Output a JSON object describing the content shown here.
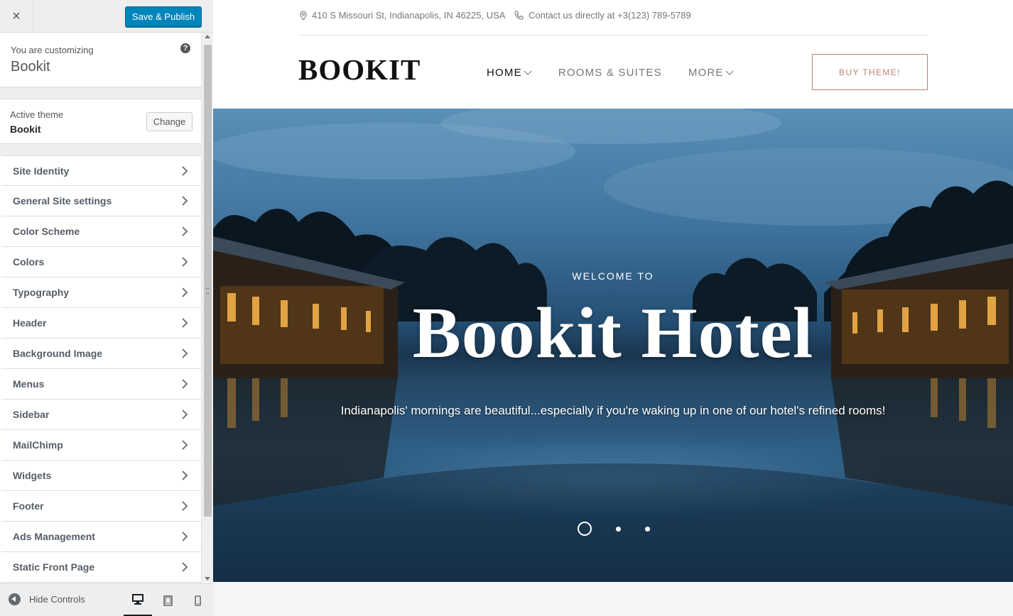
{
  "customizer": {
    "close_label": "×",
    "publish_label": "Save & Publish",
    "customizing_label": "You are customizing",
    "site_name": "Bookit",
    "help_label": "?",
    "active_theme_label": "Active theme",
    "active_theme_name": "Bookit",
    "change_label": "Change",
    "panels": [
      {
        "label": "Site Identity"
      },
      {
        "label": "General Site settings"
      },
      {
        "label": "Color Scheme"
      },
      {
        "label": "Colors"
      },
      {
        "label": "Typography"
      },
      {
        "label": "Header"
      },
      {
        "label": "Background Image"
      },
      {
        "label": "Menus"
      },
      {
        "label": "Sidebar"
      },
      {
        "label": "MailChimp"
      },
      {
        "label": "Widgets"
      },
      {
        "label": "Footer"
      },
      {
        "label": "Ads Management"
      },
      {
        "label": "Static Front Page"
      }
    ],
    "hide_controls_label": "Hide Controls",
    "devices": [
      "desktop",
      "tablet",
      "mobile"
    ],
    "active_device": "desktop",
    "accent_color": "#0085ba"
  },
  "preview": {
    "address": "410 S Missouri St, Indianapolis, IN 46225, USA",
    "contact": "Contact us directly at +3(123) 789-5789",
    "logo": "BOOKIT",
    "nav": [
      {
        "label": "HOME",
        "has_dropdown": true,
        "active": true
      },
      {
        "label": "ROOMS & SUITES",
        "has_dropdown": false,
        "active": false
      },
      {
        "label": "MORE",
        "has_dropdown": true,
        "active": false
      }
    ],
    "buy_label": "BUY THEME!",
    "buy_color": "#b8856b",
    "hero": {
      "kicker": "WELCOME TO",
      "title": "Bookit Hotel",
      "subtitle": "Indianapolis' mornings are beautiful...especially if you're waking up in one of our hotel's refined rooms!",
      "slides": 3,
      "active_slide": 1
    }
  }
}
